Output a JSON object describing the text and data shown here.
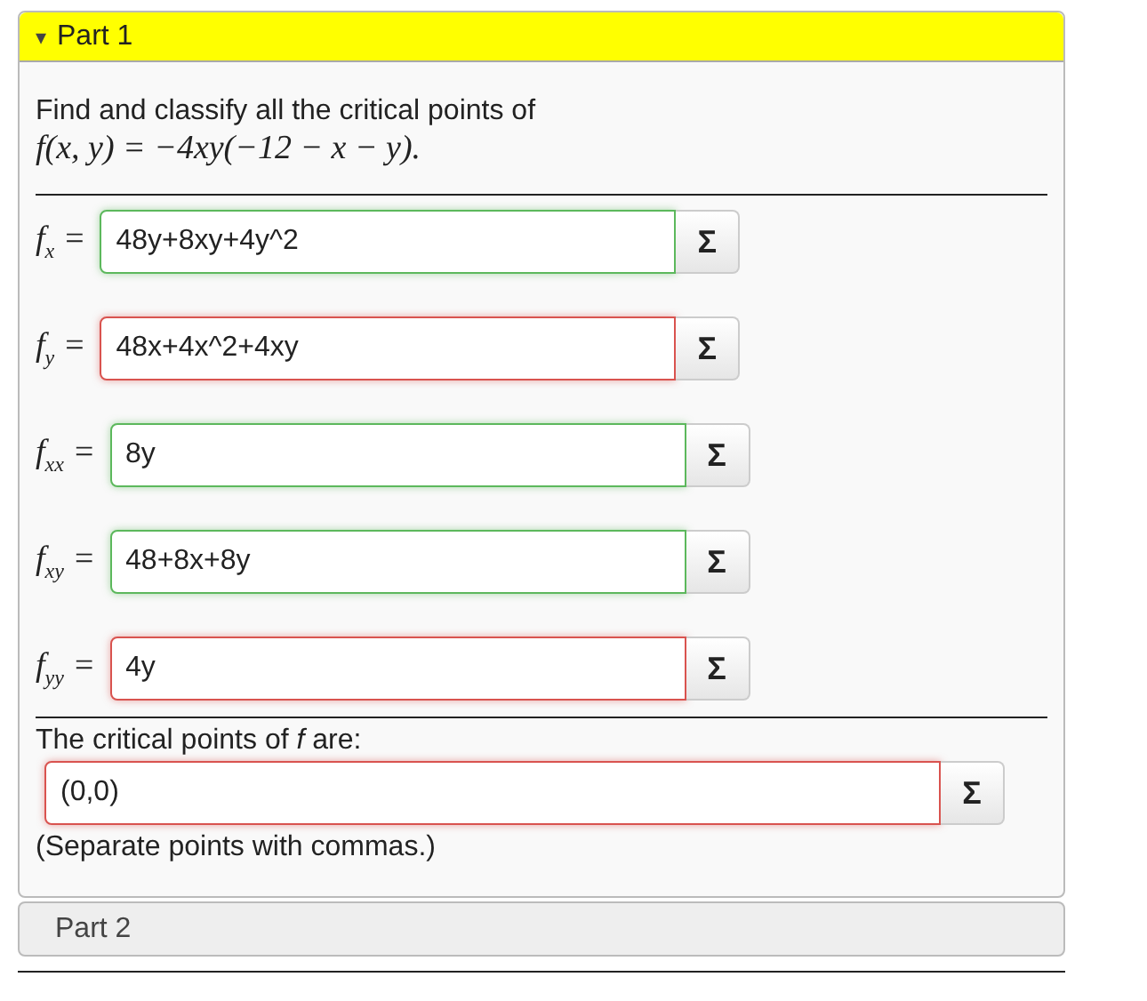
{
  "part_1": {
    "label": "Part 1",
    "expanded": true,
    "expander": "▾",
    "prompt": "Find and classify all the critical points of",
    "formula": "f(x, y) = −4xy(−12 − x − y).",
    "rows": [
      {
        "label": "f$_{x}$ =",
        "value": "48y+8xy+4y^2",
        "correct": true,
        "button": "Σ"
      },
      {
        "label": "f$_{y}$ =",
        "value": "48x+4x^2+4xy",
        "correct": false,
        "button": "Σ"
      },
      {
        "label": "f$_{xx}$ =",
        "value": "8y",
        "correct": true,
        "button": "Σ"
      },
      {
        "label": "f$_{xy}$ =",
        "value": "48+8x+8y",
        "correct": true,
        "button": "Σ"
      },
      {
        "label": "f$_{yy}$ =",
        "value": "4y",
        "correct": false,
        "button": "Σ"
      }
    ],
    "critical_prompt": "The critical points of *f* are:",
    "critical_field": {
      "value": "(0,0)",
      "correct": false,
      "button": "Σ"
    },
    "hint": "(Separate points with commas.)"
  },
  "part_2": {
    "label": "Part 2",
    "expanded": false
  }
}
